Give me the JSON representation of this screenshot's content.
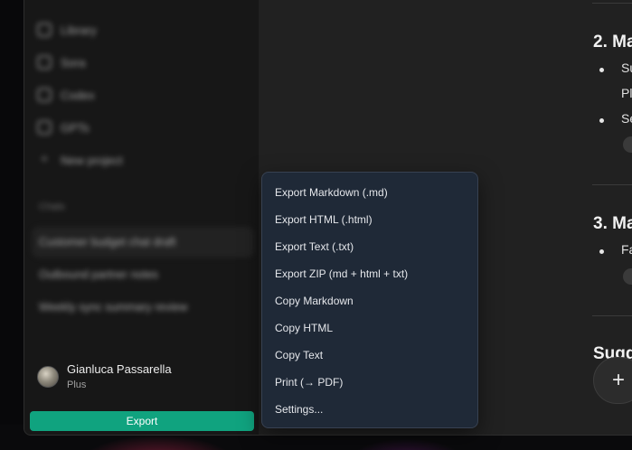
{
  "sidebar": {
    "nav_items": [
      {
        "label": "Library",
        "icon": "library-icon"
      },
      {
        "label": "Sora",
        "icon": "video-icon"
      },
      {
        "label": "Codex",
        "icon": "code-icon"
      },
      {
        "label": "GPTs",
        "icon": "grid-icon"
      },
      {
        "label": "New project",
        "icon": "plus-icon"
      }
    ],
    "chats_label": "Chats",
    "chats": [
      {
        "label": "Customer budget chat draft",
        "active": true
      },
      {
        "label": "Outbound partner notes",
        "active": false
      },
      {
        "label": "Weekly sync summary review",
        "active": false
      }
    ],
    "user": {
      "name": "Gianluca Passarella",
      "plan": "Plus"
    },
    "export_label": "Export"
  },
  "main": {
    "heading_2": "2. Ma",
    "heading_3": "3. Ma",
    "heading_suggest": "Sugg",
    "text_su": "Su",
    "text_pl": "Pl",
    "text_se": "Se",
    "text_fa": "Fa",
    "fab_label": "+"
  },
  "export_menu": {
    "items": [
      "Export Markdown (.md)",
      "Export HTML (.html)",
      "Export Text (.txt)",
      "Export ZIP (md + html + txt)",
      "Copy Markdown",
      "Copy HTML",
      "Copy Text",
      "Print (→ PDF)",
      "Settings..."
    ]
  },
  "colors": {
    "accent": "#10a37f",
    "menu_bg": "#1f2937",
    "app_bg": "#212121",
    "sidebar_bg": "#171717"
  }
}
